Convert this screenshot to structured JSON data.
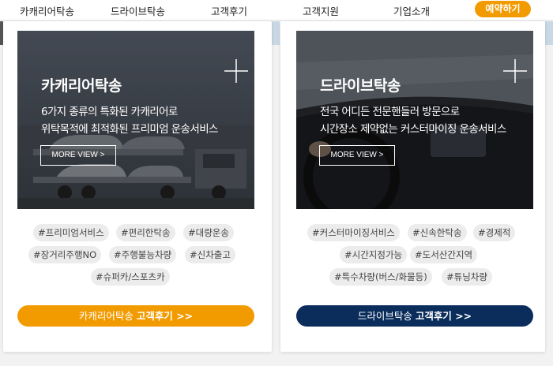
{
  "nav": {
    "items": [
      "카캐리어탁송",
      "드라이브탁송",
      "고객후기",
      "고객지원",
      "기업소개"
    ],
    "reserve_label": "예약하기"
  },
  "colors": {
    "accent_orange": "#f29b00",
    "navy": "#0b2d5c",
    "tag_bg": "#ececec"
  },
  "cards": [
    {
      "title": "카캐리어탁송",
      "desc_line1": "6가지 종류의 특화된 카캐리어로",
      "desc_line2": "위탁목적에 최적화된 프리미엄 운송서비스",
      "more_label": "MORE VIEW >",
      "tags": [
        "#프리미엄서비스",
        "#편리한탁송",
        "#대량운송",
        "#장거리주행NO",
        "#주행불능차량",
        "#신차출고",
        "#슈퍼카/스포츠카"
      ],
      "cta_prefix": "카캐리어탁송",
      "cta_bold": "고객후기 >>"
    },
    {
      "title": "드라이브탁송",
      "desc_line1": "전국 어디든 전문핸들러 방문으로",
      "desc_line2": "시간장소 제약없는 커스터마이징 운송서비스",
      "more_label": "MORE VIEW >",
      "tags": [
        "#커스터마이징서비스",
        "#신속한탁송",
        "#경제적",
        "#시간지정가능",
        "#도서산간지역",
        "#특수차량(버스/화물등)",
        "#튜닝차량"
      ],
      "cta_prefix": "드라이브탁송",
      "cta_bold": "고객후기 >>"
    }
  ]
}
